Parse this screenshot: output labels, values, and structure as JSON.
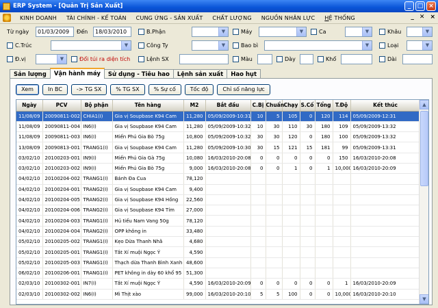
{
  "window": {
    "title": "ERP System - [Quản Trị Sản Xuất]",
    "min": "_",
    "max": "□",
    "close": "×"
  },
  "menu": {
    "items": [
      "KINH DOANH",
      "TÀI CHÍNH - KẾ TOÁN",
      "CUNG ỨNG - SẢN XUẤT",
      "CHẤT LƯỢNG",
      "NGUỒN NHÂN LỰC"
    ],
    "he_thong_u": "H",
    "he_thong_rest": "Ệ THỐNG",
    "mdi": [
      "_",
      "✕",
      "×"
    ]
  },
  "filters": {
    "tu_ngay_label": "Từ ngày",
    "tu_ngay": "01/03/2009",
    "den_label": "Đến",
    "den": "18/03/2010",
    "bphan_label": "B.Phận",
    "may_label": "Máy",
    "ca_label": "Ca",
    "khau_label": "Khâu",
    "ctruc_label": "C.Trúc",
    "cong_ty_label": "Công Ty",
    "bao_bi_label": "Bao bì",
    "loai_label": "Loại",
    "dvi_label": "Đ.vị",
    "doi_tui_label": "Đổi túi ra diện tích",
    "lenh_sx_label": "Lệnh SX",
    "mau_label": "Màu",
    "day_label": "Dày",
    "kho_label": "Khổ",
    "dai_label": "Dài"
  },
  "tabs": [
    "Sản lượng",
    "Vận hành máy",
    "Sử dụng - Tiêu hao",
    "Lệnh sản xuất",
    "Hao hụt"
  ],
  "active_tab": 1,
  "buttons": [
    "Xem",
    "In BC",
    "-> TG SX",
    "% TG SX",
    "% Sự cố",
    "Tốc độ",
    "Chỉ số năng lực"
  ],
  "table": {
    "headers": [
      "Ngày",
      "PCV",
      "Bộ phận",
      "Tên hàng",
      "M2",
      "Bắt đầu",
      "C.Bị",
      "Chuẩn",
      "Chạy",
      "S.Cố",
      "Tổng",
      "T.Độ",
      "Kết thúc"
    ],
    "rows": [
      [
        "11/08/09",
        "20090811-002",
        "CHIA1(I)",
        "Gia vị Soupbase K94 Cam",
        "11,280",
        "05/09/2009-10:31",
        "10",
        "5",
        "105",
        "0",
        "120",
        "114",
        "05/09/2009-12:31"
      ],
      [
        "11/08/09",
        "20090811-004",
        "IN6(I)",
        "Gia vị Soupbase K94 Cam",
        "11,280",
        "05/09/2009-10:32",
        "10",
        "30",
        "110",
        "30",
        "180",
        "109",
        "05/09/2009-13:32"
      ],
      [
        "11/08/09",
        "20090811-003",
        "IN6(I)",
        "Miến Phú Gia Bò 75g",
        "10,800",
        "05/09/2009-10:32",
        "30",
        "30",
        "120",
        "0",
        "180",
        "100",
        "05/09/2009-13:32"
      ],
      [
        "13/08/09",
        "20090813-001",
        "TRANG1(I)",
        "Gia vị Soupbase K94 Cam",
        "11,280",
        "05/09/2009-10:30",
        "30",
        "15",
        "121",
        "15",
        "181",
        "99",
        "05/09/2009-13:31"
      ],
      [
        "03/02/10",
        "20100203-001",
        "IN9(I)",
        "Miến Phú Gia Gà 75g",
        "10,080",
        "16/03/2010-20:08",
        "0",
        "0",
        "0",
        "0",
        "0",
        "150",
        "16/03/2010-20:08"
      ],
      [
        "03/02/10",
        "20100203-002",
        "IN9(I)",
        "Miến Phú Gia Bò 75g",
        "9,000",
        "16/03/2010-20:08",
        "0",
        "0",
        "1",
        "0",
        "1",
        "10,000",
        "16/03/2010-20:09"
      ],
      [
        "04/02/10",
        "20100204-002",
        "TRANG1(I)",
        "Bánh Đa Cua",
        "78,120",
        "",
        "",
        "",
        "",
        "",
        "",
        "",
        ""
      ],
      [
        "04/02/10",
        "20100204-001",
        "TRANG2(I)",
        "Gia vị Soupbase K94 Cam",
        "9,400",
        "",
        "",
        "",
        "",
        "",
        "",
        "",
        ""
      ],
      [
        "04/02/10",
        "20100204-005",
        "TRANG2(I)",
        "Gia vị Soupbase K94 Hồng",
        "22,560",
        "",
        "",
        "",
        "",
        "",
        "",
        "",
        ""
      ],
      [
        "04/02/10",
        "20100204-006",
        "TRANG2(I)",
        "Gia vị Soupbase K94 Tím",
        "27,000",
        "",
        "",
        "",
        "",
        "",
        "",
        "",
        ""
      ],
      [
        "04/02/10",
        "20100204-003",
        "TRANG1(I)",
        "Hủ tiếu Nam Vang 50g",
        "78,120",
        "",
        "",
        "",
        "",
        "",
        "",
        "",
        ""
      ],
      [
        "04/02/10",
        "20100204-004",
        "TRANG2(I)",
        "OPP không in",
        "33,480",
        "",
        "",
        "",
        "",
        "",
        "",
        "",
        ""
      ],
      [
        "05/02/10",
        "20100205-002",
        "TRANG1(I)",
        "Kẹo Dừa Thanh Nhã",
        "4,680",
        "",
        "",
        "",
        "",
        "",
        "",
        "",
        ""
      ],
      [
        "05/02/10",
        "20100205-001",
        "TRANG1(I)",
        "Tắt Xí muội Ngọc Ý",
        "4,590",
        "",
        "",
        "",
        "",
        "",
        "",
        "",
        ""
      ],
      [
        "05/02/10",
        "20100205-003",
        "TRANG1(I)",
        "Thạch dừa Thanh Bình Xanh Dư...",
        "48,600",
        "",
        "",
        "",
        "",
        "",
        "",
        "",
        ""
      ],
      [
        "06/02/10",
        "20100206-001",
        "TRANG1(I)",
        "PET không in dày 60 khổ 95",
        "51,300",
        "",
        "",
        "",
        "",
        "",
        "",
        "",
        ""
      ],
      [
        "02/03/10",
        "20100302-001",
        "IN7(I)",
        "Tắt Xí muội Ngọc Ý",
        "4,590",
        "16/03/2010-20:09",
        "0",
        "0",
        "0",
        "0",
        "0",
        "1",
        "16/03/2010-20:09"
      ],
      [
        "02/03/10",
        "20100302-002",
        "IN6(I)",
        "Mì Thịt xào",
        "99,000",
        "16/03/2010-20:10",
        "5",
        "5",
        "100",
        "0",
        "0",
        "10,000",
        "16/03/2010-20:10"
      ]
    ],
    "selected_row": 0
  }
}
